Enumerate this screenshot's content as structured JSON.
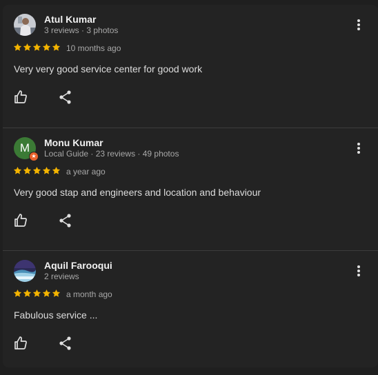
{
  "colors": {
    "background": "#1f1f1f",
    "panel": "#232323",
    "star": "#f4b400",
    "divider": "#3c3c3c",
    "local_guide_badge": "#e8632c",
    "monu_avatar": "#3b7a35"
  },
  "reviews": [
    {
      "name": "Atul Kumar",
      "meta": "3 reviews · 3 photos",
      "rating": 5,
      "date": "10 months ago",
      "text": "Very very good service center for good work",
      "avatar": "photo-person"
    },
    {
      "name": "Monu Kumar",
      "meta": "Local Guide · 23 reviews · 49 photos",
      "rating": 5,
      "date": "a year ago",
      "text": "Very good stap and engineers and location and behaviour",
      "avatar_initial": "M",
      "local_guide": true
    },
    {
      "name": "Aquil Farooqui",
      "meta": "2 reviews",
      "rating": 5,
      "date": "a month ago",
      "text": "Fabulous service ...",
      "avatar": "photo-landscape"
    }
  ],
  "icons": {
    "more": "more-vert-icon",
    "like": "thumb-up-icon",
    "share": "share-icon",
    "star": "star-icon"
  }
}
